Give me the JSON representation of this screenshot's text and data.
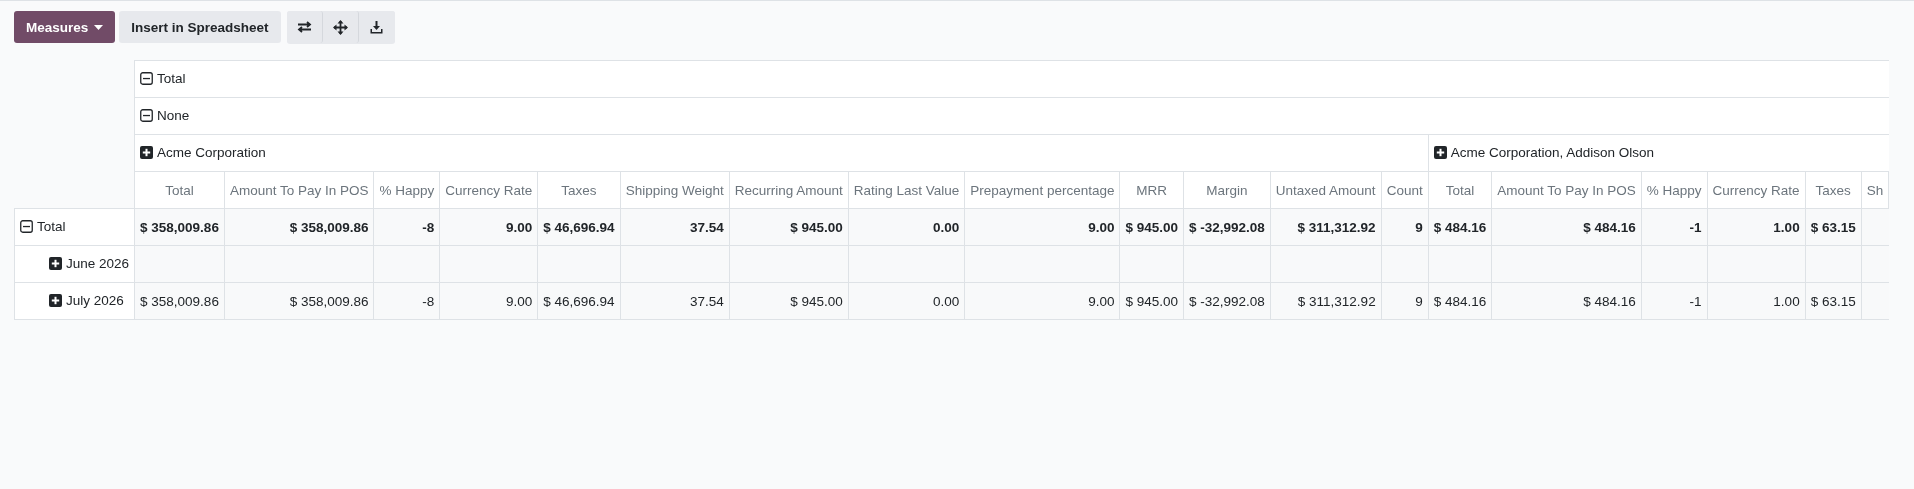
{
  "toolbar": {
    "measures_button": "Measures",
    "insert_button": "Insert in Spreadsheet"
  },
  "col_headers": [
    {
      "label": "Total",
      "expanded": true
    },
    {
      "label": "None",
      "expanded": true
    }
  ],
  "groups": [
    {
      "label": "Acme Corporation",
      "expanded": false,
      "measures": [
        "Total",
        "Amount To Pay In POS",
        "% Happy",
        "Currency Rate",
        "Taxes",
        "Shipping Weight",
        "Recurring Amount",
        "Rating Last Value",
        "Prepayment percentage",
        "MRR",
        "Margin",
        "Untaxed Amount",
        "Count"
      ]
    },
    {
      "label": "Acme Corporation, Addison Olson",
      "expanded": false,
      "measures": [
        "Total",
        "Amount To Pay In POS",
        "% Happy",
        "Currency Rate",
        "Taxes",
        "Sh"
      ]
    }
  ],
  "rows": [
    {
      "label": "Total",
      "expanded": true,
      "cells": [
        "$ 358,009.86",
        "$ 358,009.86",
        "-8",
        "9.00",
        "$ 46,696.94",
        "37.54",
        "$ 945.00",
        "0.00",
        "9.00",
        "$ 945.00",
        "$ -32,992.08",
        "$ 311,312.92",
        "9",
        "$ 484.16",
        "$ 484.16",
        "-1",
        "1.00",
        "$ 63.15"
      ],
      "children": [
        {
          "label": "June 2026",
          "expanded": false
        },
        {
          "label": "July 2026",
          "expanded": false,
          "cells": [
            "$ 358,009.86",
            "$ 358,009.86",
            "-8",
            "9.00",
            "$ 46,696.94",
            "37.54",
            "$ 945.00",
            "0.00",
            "9.00",
            "$ 945.00",
            "$ -32,992.08",
            "$ 311,312.92",
            "9",
            "$ 484.16",
            "$ 484.16",
            "-1",
            "1.00",
            "$ 63.15"
          ]
        }
      ]
    }
  ]
}
